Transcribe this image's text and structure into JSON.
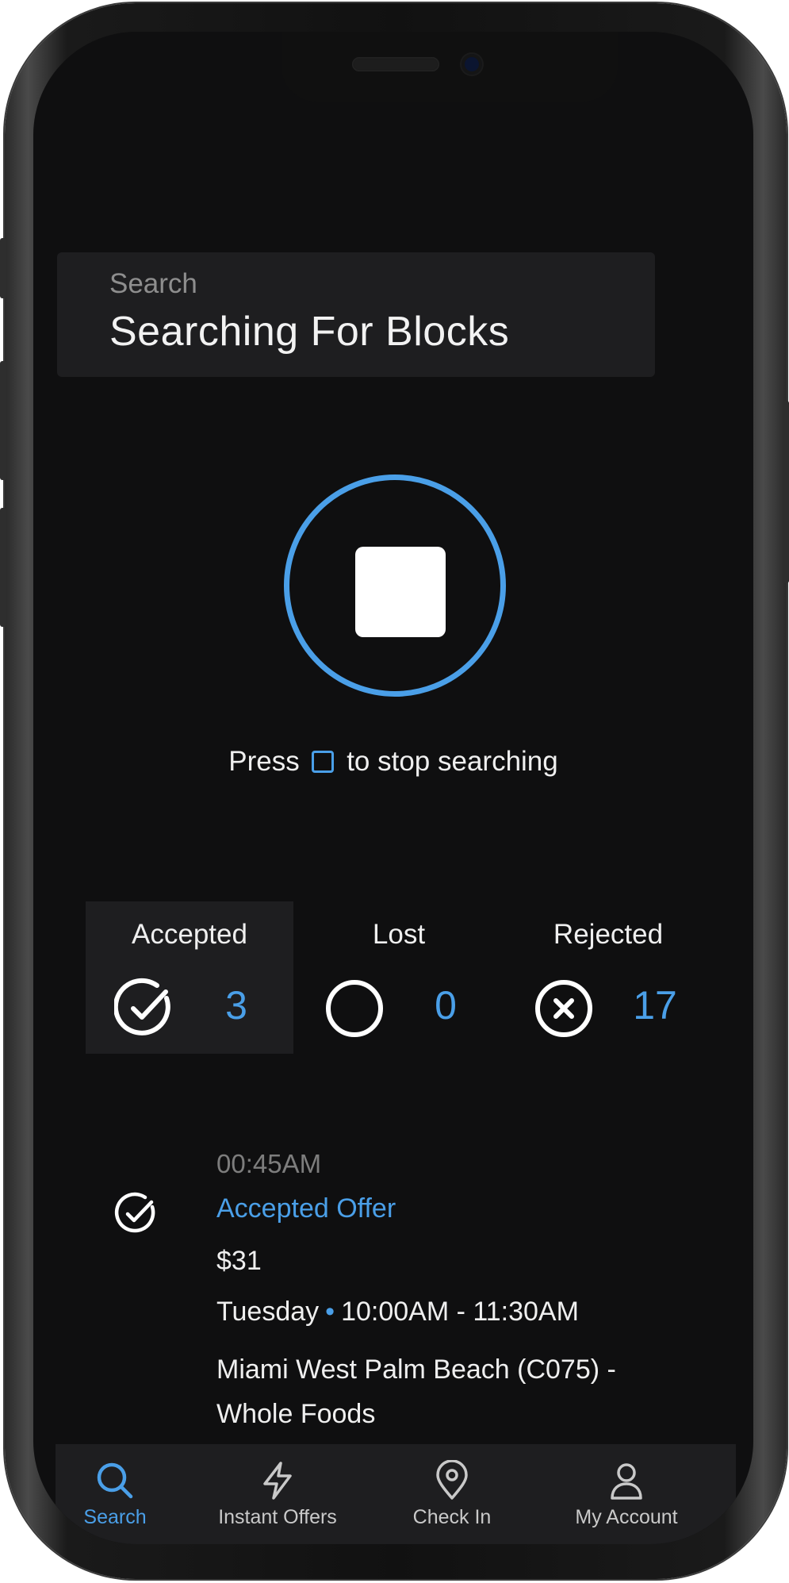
{
  "header": {
    "label": "Search",
    "title": "Searching For Blocks"
  },
  "stop": {
    "hint_prefix": "Press",
    "hint_suffix": "to stop searching"
  },
  "stats": [
    {
      "label": "Accepted",
      "value": "3",
      "icon": "check-circle-icon",
      "selected": true
    },
    {
      "label": "Lost",
      "value": "0",
      "icon": "empty-circle-icon",
      "selected": false
    },
    {
      "label": "Rejected",
      "value": "17",
      "icon": "x-circle-icon",
      "selected": false
    }
  ],
  "activity": {
    "time": "00:45AM",
    "status": "Accepted Offer",
    "price": "$31",
    "day": "Tuesday",
    "window": "10:00AM - 11:30AM",
    "location": "Miami West Palm Beach (C075) - Whole Foods",
    "icon": "check-circle-icon"
  },
  "tabs": [
    {
      "label": "Search",
      "icon": "search-icon",
      "active": true
    },
    {
      "label": "Instant Offers",
      "icon": "lightning-icon",
      "active": false
    },
    {
      "label": "Check In",
      "icon": "location-pin-icon",
      "active": false
    },
    {
      "label": "My Account",
      "icon": "user-icon",
      "active": false
    }
  ],
  "colors": {
    "accent": "#4a9fe8",
    "background": "#0f0f10",
    "card": "#1e1e20",
    "text": "#efefef",
    "muted": "#7d7d7d"
  }
}
